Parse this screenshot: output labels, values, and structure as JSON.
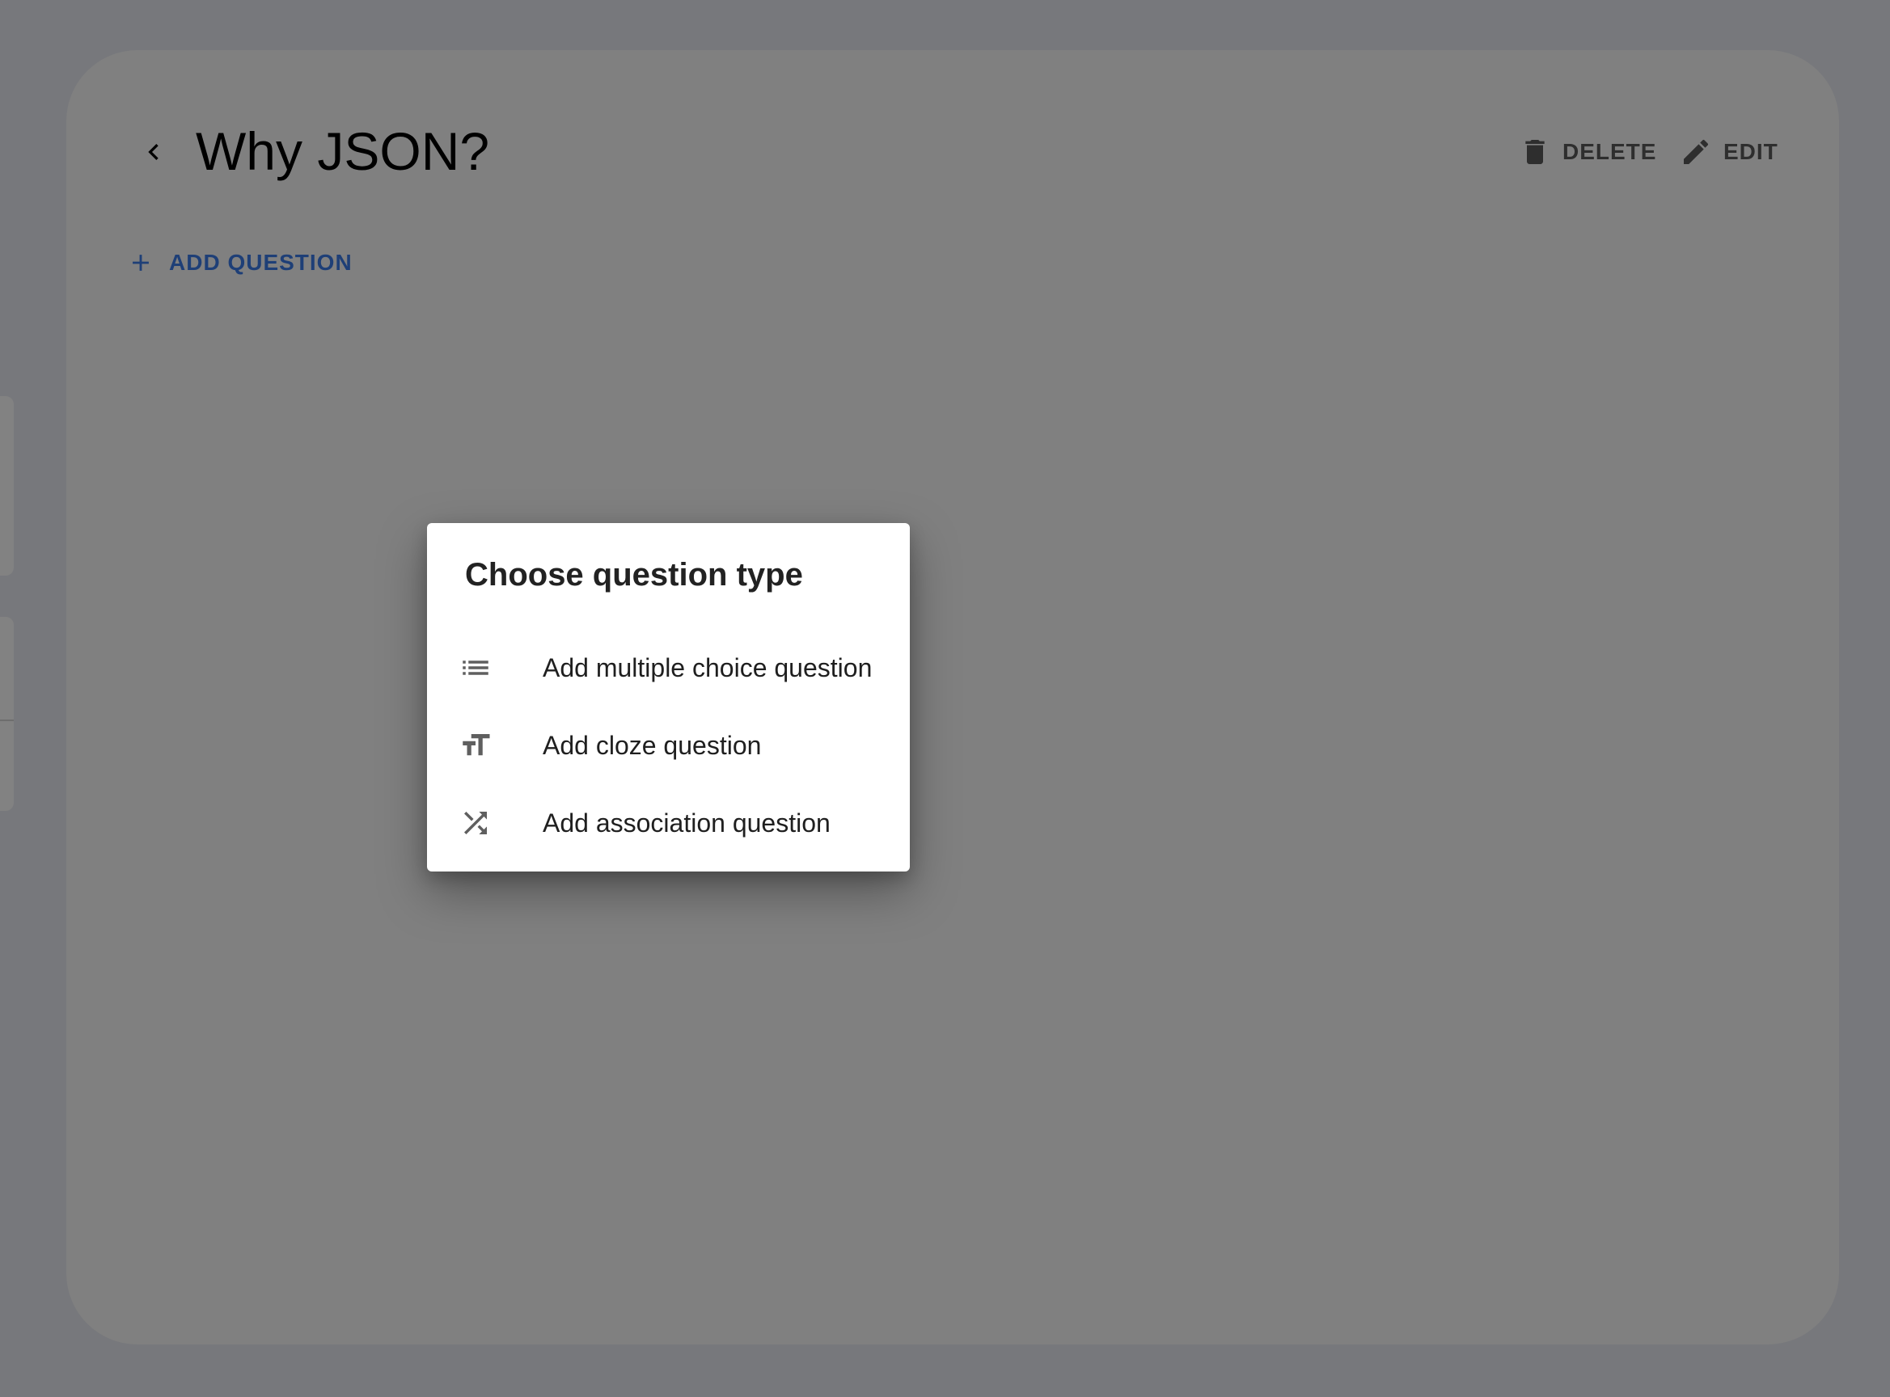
{
  "header": {
    "title": "Why JSON?",
    "back_icon": "chevron-left-icon",
    "delete_label": "DELETE",
    "delete_icon": "trash-icon",
    "edit_label": "EDIT",
    "edit_icon": "pencil-icon"
  },
  "toolbar": {
    "add_question_label": "ADD QUESTION",
    "add_question_icon": "plus-icon"
  },
  "dialog": {
    "title": "Choose question type",
    "options": [
      {
        "label": "Add multiple choice question",
        "icon": "list-icon"
      },
      {
        "label": "Add cloze question",
        "icon": "text-size-icon"
      },
      {
        "label": "Add association question",
        "icon": "shuffle-icon"
      }
    ]
  },
  "colors": {
    "backdrop": "#77787c",
    "panel": "#808080",
    "accent": "#1e3f77",
    "dialog_bg": "#ffffff"
  }
}
